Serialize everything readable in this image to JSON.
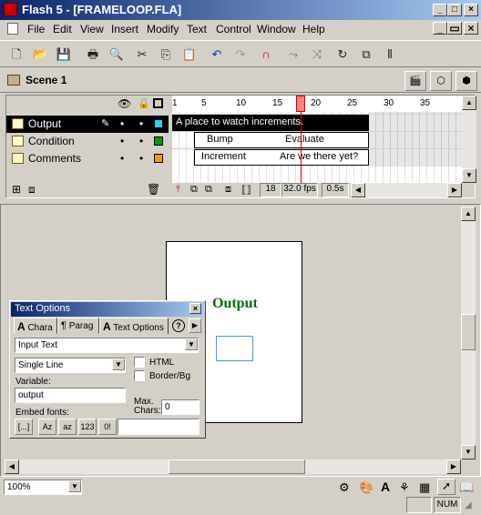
{
  "window": {
    "title": "Flash 5 - [FRAMELOOP.FLA]"
  },
  "menu": [
    "File",
    "Edit",
    "View",
    "Insert",
    "Modify",
    "Text",
    "Control",
    "Window",
    "Help"
  ],
  "toolbar_icons": [
    "new-icon",
    "open-icon",
    "save-icon",
    "print-icon",
    "print-preview-icon",
    "cut-icon",
    "copy-icon",
    "paste-icon",
    "undo-icon",
    "redo-icon",
    "snap-magnet-icon",
    "smooth-icon",
    "straighten-icon",
    "rotate-icon",
    "scale-icon",
    "align-icon"
  ],
  "scene": {
    "name": "Scene 1"
  },
  "timeline": {
    "ruler": [
      "1",
      "5",
      "10",
      "15",
      "20",
      "25",
      "30",
      "35"
    ],
    "layers": [
      {
        "name": "Output",
        "color": "#33ccff",
        "selected": true
      },
      {
        "name": "Condition",
        "color": "#009900",
        "selected": false
      },
      {
        "name": "Comments",
        "color": "#ff9900",
        "selected": false
      }
    ],
    "frame_labels": {
      "comment": "A place to watch increments.",
      "bump": "Bump",
      "evaluate": "Evaluate",
      "increment": "Increment",
      "are_we_there": "Are we there yet?"
    },
    "current_frame": "18",
    "fps": "32.0 fps",
    "elapsed": "0.5s"
  },
  "stage": {
    "output_label": "Output"
  },
  "text_options_panel": {
    "title": "Text Options",
    "tabs": [
      "Chara",
      "Parag",
      "Text Options"
    ],
    "text_type": "Input Text",
    "line_type": "Single Line",
    "html_label": "HTML",
    "border_label": "Border/Bg",
    "variable_label": "Variable:",
    "variable_value": "output",
    "max_chars_label": "Max.\nChars:",
    "max_chars_value": "0",
    "embed_fonts_label": "Embed fonts:",
    "embed_buttons": [
      "[...]",
      "Az",
      "az",
      "123",
      "0!"
    ]
  },
  "status": {
    "zoom": "100%",
    "num": "NUM"
  }
}
